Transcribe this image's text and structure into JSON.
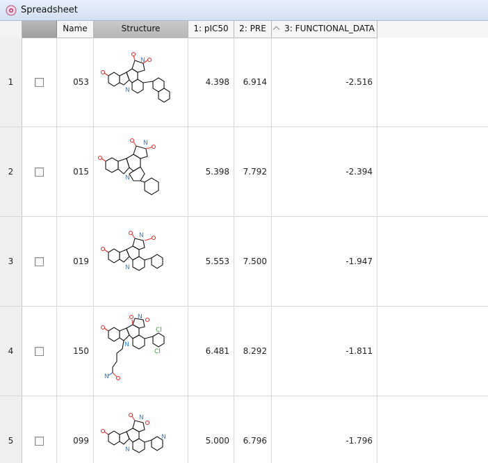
{
  "window": {
    "title": "Spreadsheet"
  },
  "columns": {
    "name": "Name",
    "structure": "Structure",
    "pic50": "1: pIC50",
    "pre": "2: PRE",
    "functional": "3: FUNCTIONAL_DATA"
  },
  "rows": [
    {
      "index": "1",
      "name": "053",
      "pic50": "4.398",
      "pre": "6.914",
      "functional": "-2.516"
    },
    {
      "index": "2",
      "name": "015",
      "pic50": "5.398",
      "pre": "7.792",
      "functional": "-2.394"
    },
    {
      "index": "3",
      "name": "019",
      "pic50": "5.553",
      "pre": "7.500",
      "functional": "-1.947"
    },
    {
      "index": "4",
      "name": "150",
      "pic50": "6.481",
      "pre": "8.292",
      "functional": "-1.811"
    },
    {
      "index": "5",
      "name": "099",
      "pic50": "5.000",
      "pre": "6.796",
      "functional": "-1.796"
    }
  ],
  "atom_labels": {
    "nitrogen": "N",
    "chlorine": "Cl"
  },
  "colors": {
    "oxygen": "#e03030",
    "nitrogen": "#2a7fd8",
    "chlorine": "#2fa52f",
    "bond": "#111111"
  }
}
